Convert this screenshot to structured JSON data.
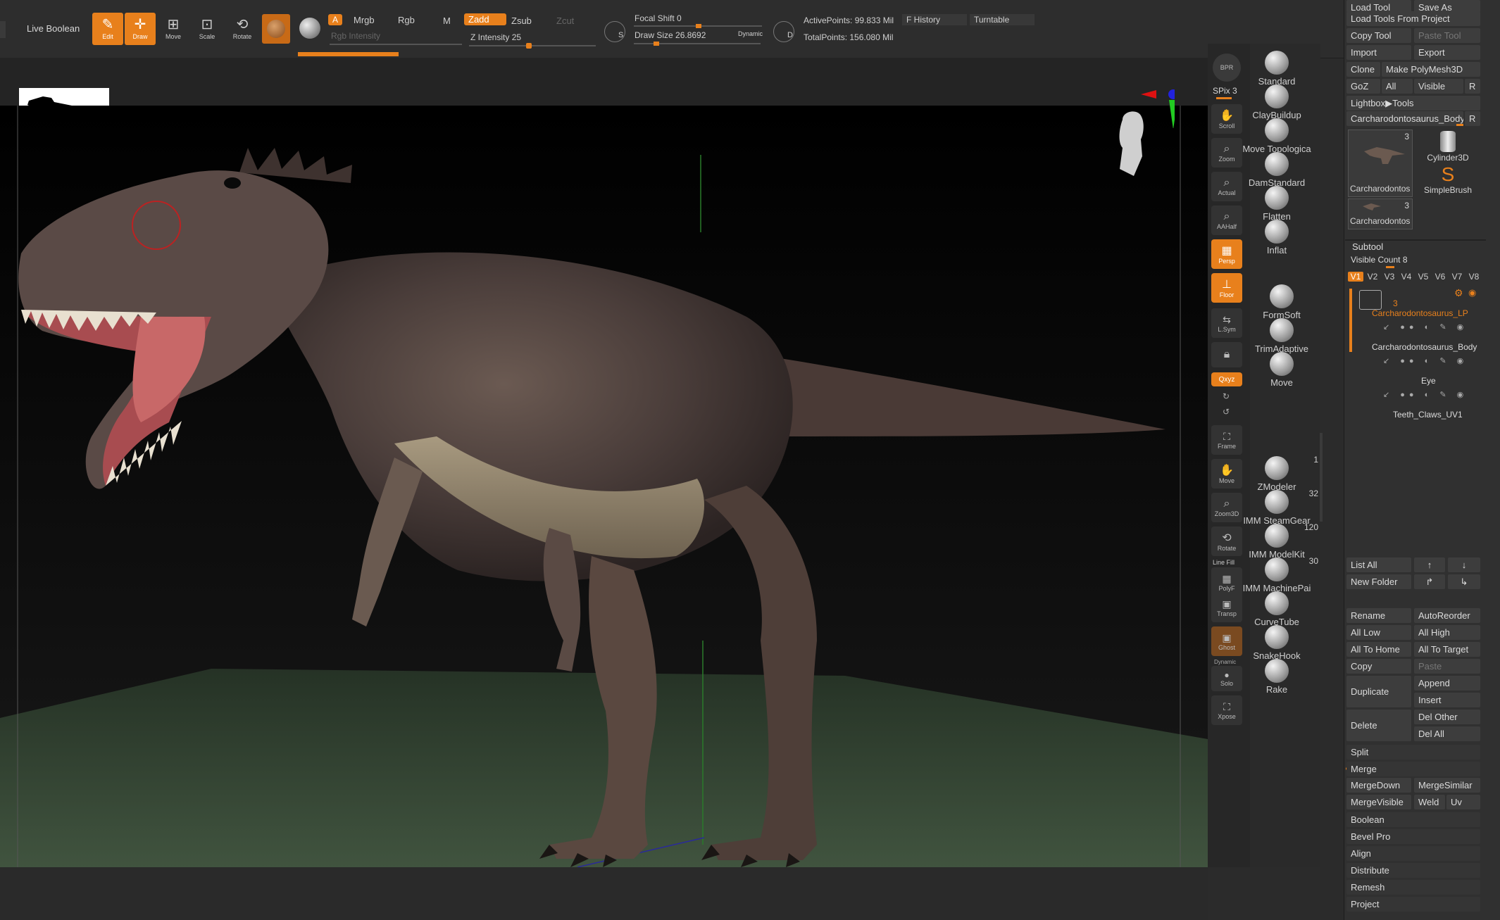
{
  "toolbar": {
    "live_boolean": "Live Boolean",
    "edit": "Edit",
    "draw": "Draw",
    "move": "Move",
    "scale": "Scale",
    "rotate": "Rotate",
    "a": "A",
    "mrgb": "Mrgb",
    "rgb": "Rgb",
    "m": "M",
    "rgb_intensity": "Rgb Intensity",
    "zadd": "Zadd",
    "zsub": "Zsub",
    "zcut": "Zcut",
    "z_intensity": "Z Intensity 25",
    "z_intensity_value": 25,
    "focal_shift": "Focal Shift 0",
    "draw_size": "Draw Size 26.8692",
    "dynamic": "Dynamic",
    "active_points": "ActivePoints: 99.833 Mil",
    "total_points": "TotalPoints: 156.080 Mil",
    "f_history": "F History",
    "turntable": "Turntable",
    "s_label": "S",
    "d_label": "D"
  },
  "shelf": {
    "bpr": "BPR",
    "spix": "SPix 3",
    "scroll": "Scroll",
    "zoom": "Zoom",
    "actual": "Actual",
    "aahalf": "AAHalf",
    "persp": "Persp",
    "floor": "Floor",
    "lsym": "L.Sym",
    "xyz": "Qxyz",
    "frame": "Frame",
    "move": "Move",
    "zoom3d": "Zoom3D",
    "rotate": "Rotate",
    "line_fill": "Line Fill",
    "polyf": "PolyF",
    "transp": "Transp",
    "ghost": "Ghost",
    "dynamic": "Dynamic",
    "solo": "Solo",
    "xpose": "Xpose"
  },
  "brushes": [
    {
      "name": "Standard",
      "count": ""
    },
    {
      "name": "ClayBuildup",
      "count": ""
    },
    {
      "name": "Move Topologica",
      "count": ""
    },
    {
      "name": "DamStandard",
      "count": ""
    },
    {
      "name": "Flatten",
      "count": ""
    },
    {
      "name": "Inflat",
      "count": ""
    },
    {
      "name": "FormSoft",
      "count": ""
    },
    {
      "name": "TrimAdaptive",
      "count": ""
    },
    {
      "name": "Move",
      "count": ""
    },
    {
      "name": "ZModeler",
      "count": "1"
    },
    {
      "name": "IMM SteamGear",
      "count": "32"
    },
    {
      "name": "IMM ModelKit",
      "count": "120"
    },
    {
      "name": "IMM MachinePai",
      "count": "30"
    },
    {
      "name": "CurveTube",
      "count": ""
    },
    {
      "name": "SnakeHook",
      "count": ""
    },
    {
      "name": "Rake",
      "count": ""
    }
  ],
  "tool_panel": {
    "load_tool": "Load Tool",
    "save_as": "Save As",
    "load_from_project": "Load Tools From Project",
    "copy_tool": "Copy Tool",
    "paste_tool": "Paste Tool",
    "import": "Import",
    "export": "Export",
    "clone": "Clone",
    "make_polymesh": "Make PolyMesh3D",
    "goz": "GoZ",
    "all": "All",
    "visible": "Visible",
    "r": "R",
    "lightbox_tools": "Lightbox▶Tools",
    "current_tool": "Carcharodontosaurus_Body",
    "thumb1_label": "Carcharodontos",
    "thumb1_count": "3",
    "thumb2_label": "Carcharodontos",
    "thumb2_count": "3",
    "cylinder": "Cylinder3D",
    "simplebrush": "SimpleBrush"
  },
  "subtool": {
    "title": "Subtool",
    "visible_count": "Visible Count 8",
    "tabs": [
      "V1",
      "V2",
      "V3",
      "V4",
      "V5",
      "V6",
      "V7",
      "V8"
    ],
    "folder_count": "3",
    "items": [
      {
        "name": "Carcharodontosaurus_LP",
        "highlight": true
      },
      {
        "name": "Carcharodontosaurus_Body",
        "highlight": false
      },
      {
        "name": "Eye",
        "highlight": false
      },
      {
        "name": "Teeth_Claws_UV1",
        "highlight": false
      }
    ],
    "list_all": "List All",
    "new_folder": "New Folder",
    "rename": "Rename",
    "autoreorder": "AutoReorder",
    "all_low": "All Low",
    "all_high": "All High",
    "all_to_home": "All To Home",
    "all_to_target": "All To Target",
    "copy": "Copy",
    "paste": "Paste",
    "duplicate": "Duplicate",
    "append": "Append",
    "insert": "Insert",
    "delete": "Delete",
    "del_other": "Del Other",
    "del_all": "Del All",
    "split": "Split",
    "merge": "Merge",
    "mergedown": "MergeDown",
    "mergesimilar": "MergeSimilar",
    "mergevisible": "MergeVisible",
    "weld": "Weld",
    "uv": "Uv",
    "boolean": "Boolean",
    "bevel_pro": "Bevel Pro",
    "align": "Align",
    "distribute": "Distribute",
    "remesh": "Remesh",
    "project": "Project"
  },
  "colors": {
    "accent": "#e8801c",
    "panel": "#303030",
    "viewport": "#000000",
    "floor_grid": "#4a6a4a"
  }
}
